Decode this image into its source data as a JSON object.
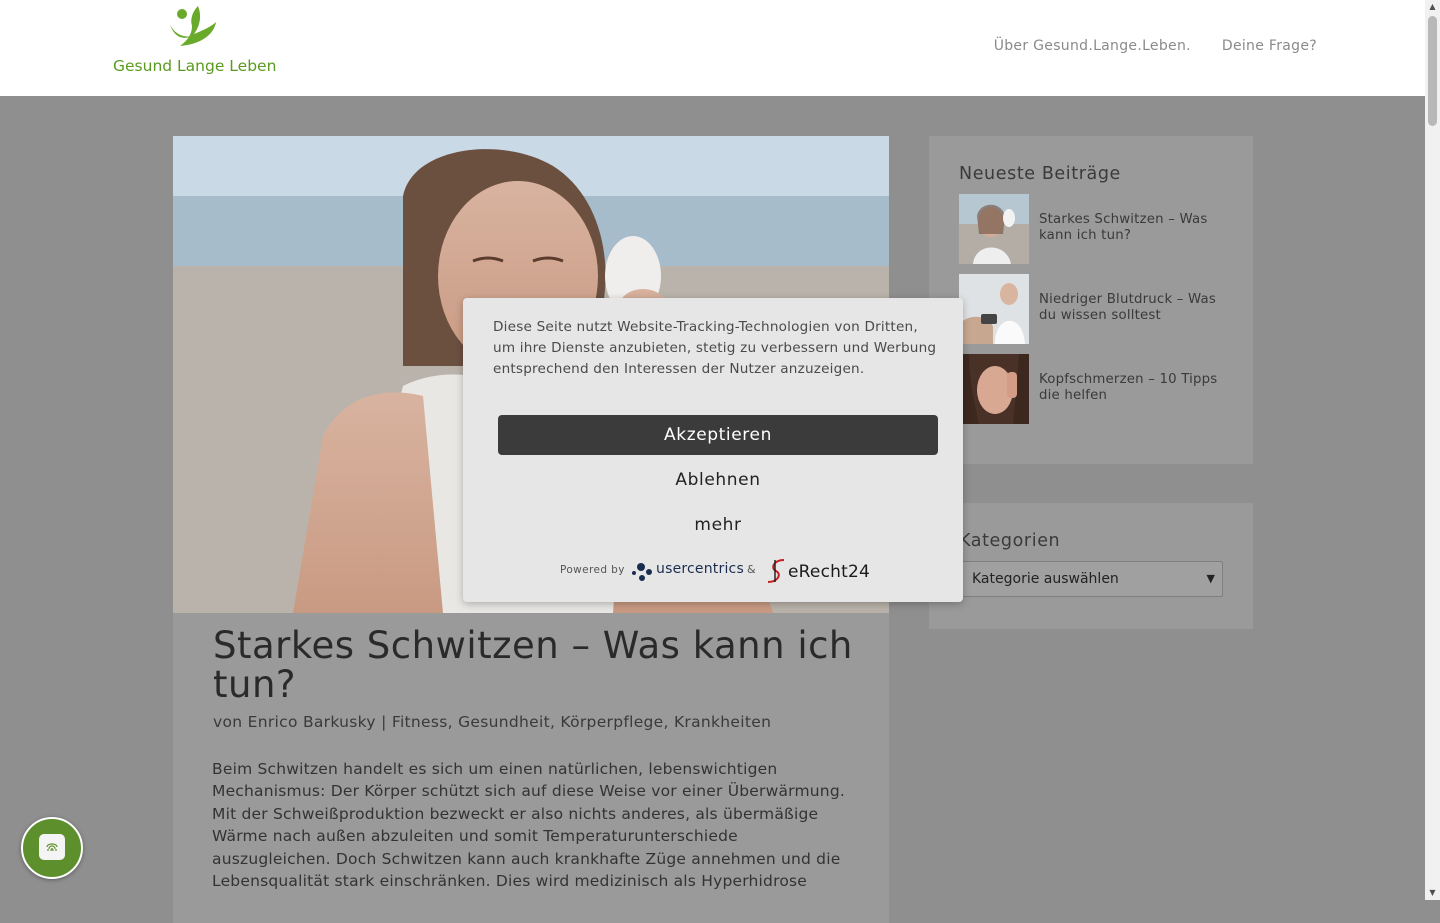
{
  "site": {
    "logo_text": "Gesund Lange Leben",
    "brand_color": "#6aaa2a"
  },
  "nav": {
    "items": [
      {
        "label": "Über Gesund.Lange.Leben."
      },
      {
        "label": "Deine Frage?"
      }
    ]
  },
  "article": {
    "title": "Starkes Schwitzen – Was kann ich tun?",
    "meta": {
      "prefix": "von",
      "author": "Enrico Barkusky",
      "separator": "|",
      "categories": "Fitness, Gesundheit, Körperpflege, Krankheiten"
    },
    "excerpt": "Beim Schwitzen handelt es sich um einen natürlichen, lebenswichtigen Mechanismus: Der Körper schützt sich auf diese Weise vor einer Überwärmung. Mit der Schweißproduktion bezweckt er also nichts anderes, als übermäßige Wärme nach außen abzuleiten und somit Temperaturunterschiede auszugleichen. Doch Schwitzen kann auch krankhafte Züge annehmen und die Lebensqualität stark einschränken. Dies wird medizinisch als Hyperhidrose"
  },
  "sidebar": {
    "recent_title": "Neueste Beiträge",
    "recent_posts": [
      {
        "label": "Starkes Schwitzen – Was kann ich tun?"
      },
      {
        "label": "Niedriger Blutdruck – Was du wissen solltest"
      },
      {
        "label": "Kopfschmerzen – 10 Tipps die helfen"
      }
    ],
    "categories_title": "Kategorien",
    "categories_select": "Kategorie auswählen"
  },
  "consent": {
    "text": "Diese Seite nutzt Website-Tracking-Technologien von Dritten, um ihre Dienste anzubieten, stetig zu verbessern und Werbung entsprechend den Interessen der Nutzer anzuzeigen.",
    "accept_label": "Akzeptieren",
    "decline_label": "Ablehnen",
    "more_label": "mehr",
    "powered_by": "Powered by",
    "provider_1": "usercentrics",
    "amp": "&",
    "provider_2": "eRecht24"
  },
  "chat": {
    "icon": "fingerprint-chat-icon",
    "color": "#5e8f2d"
  }
}
